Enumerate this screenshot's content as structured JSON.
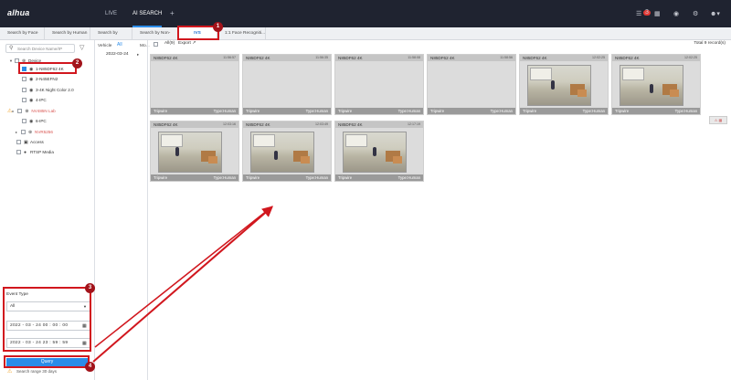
{
  "brand": {
    "logo": "alhua"
  },
  "nav": {
    "tabs": [
      {
        "label": "LIVE"
      },
      {
        "label": "AI SEARCH"
      }
    ],
    "add": "+",
    "badge": "3"
  },
  "subtabs": [
    {
      "label": "Search by Face"
    },
    {
      "label": "Search by Human"
    },
    {
      "label": "Search by Vehicle"
    },
    {
      "label": "Search by Non-Mo..."
    },
    {
      "label": "IVS"
    },
    {
      "label": "1:1 Face Recogniti..."
    }
  ],
  "sidebar": {
    "search_placeholder": "Search Device Name/IP",
    "tree": [
      {
        "label": "Device"
      },
      {
        "label": "1-N85DF62 4K"
      },
      {
        "label": "2-N45EFN2"
      },
      {
        "label": "3-4K Night Color 2.0"
      },
      {
        "label": "4-IPC"
      },
      {
        "label": "NV485N Lab"
      },
      {
        "label": "6-IPC"
      },
      {
        "label": "NVR5256"
      },
      {
        "label": "Access"
      },
      {
        "label": "RTSP Media"
      }
    ],
    "event_type_label": "Event Type",
    "event_type_value": "All",
    "start_time": "2022 - 03 - 24   00 : 00 : 00",
    "end_time": "2022 - 03 - 24   23 : 59 : 59",
    "query_label": "Query",
    "range_note": "Search range 30 days"
  },
  "dates": {
    "all": "All",
    "date": "2022-03-24"
  },
  "toolbar": {
    "all": "All(9)",
    "export": "Export",
    "total": "Total 9 record(s)"
  },
  "cards": [
    {
      "name": "N85DF62 4K",
      "time": "11:56:57",
      "event": "Tripwire",
      "type": "Type:Human",
      "snapshot": false
    },
    {
      "name": "N85DF62 4K",
      "time": "11:56:35",
      "event": "Tripwire",
      "type": "Type:Human",
      "snapshot": false
    },
    {
      "name": "N85DF62 4K",
      "time": "11:58:08",
      "event": "Tripwire",
      "type": "Type:Human",
      "snapshot": false
    },
    {
      "name": "N85DF62 4K",
      "time": "11:58:56",
      "event": "Tripwire",
      "type": "Type:Human",
      "snapshot": false
    },
    {
      "name": "N85DF62 4K",
      "time": "12:02:25",
      "event": "Tripwire",
      "type": "Type:Human",
      "snapshot": true
    },
    {
      "name": "N85DF62 4K",
      "time": "12:02:25",
      "event": "Tripwire",
      "type": "Type:Human",
      "snapshot": true
    },
    {
      "name": "N85DF62 4K",
      "time": "12:03:16",
      "event": "Tripwire",
      "type": "Type:Human",
      "snapshot": true
    },
    {
      "name": "N85DF62 4K",
      "time": "12:03:49",
      "event": "Tripwire",
      "type": "Type:Human",
      "snapshot": true
    },
    {
      "name": "N85DF62 4K",
      "time": "12:17:19",
      "event": "Tripwire",
      "type": "Type:Human",
      "snapshot": true
    }
  ],
  "annotations": {
    "markers": [
      "1",
      "2",
      "3",
      "4"
    ],
    "color": "#d1171e"
  }
}
